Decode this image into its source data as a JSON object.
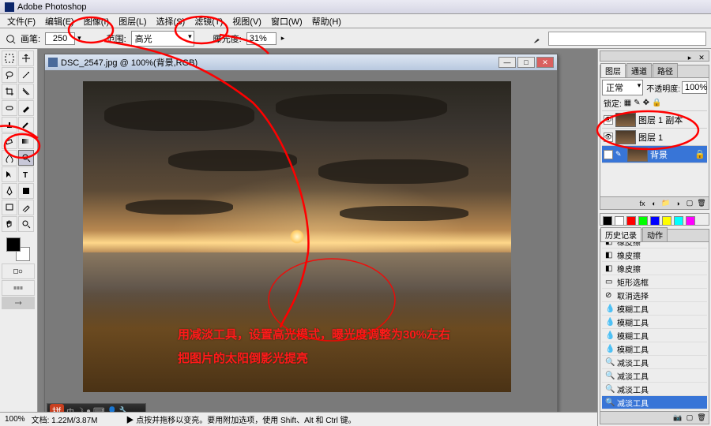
{
  "app_title": "Adobe Photoshop",
  "menu": [
    "文件(F)",
    "编辑(E)",
    "图像(I)",
    "图层(L)",
    "选择(S)",
    "滤镜(T)",
    "视图(V)",
    "窗口(W)",
    "帮助(H)"
  ],
  "options_bar": {
    "brush_label": "画笔:",
    "brush_value": "250",
    "range_label": "范围:",
    "range_value": "高光",
    "exposure_label": "曝光度:",
    "exposure_value": "31%"
  },
  "document": {
    "title": "DSC_2547.jpg @ 100%(背景,RGB)"
  },
  "annotation": {
    "line1": "用减淡工具，设置高光模式，曝光度调整为30%左右",
    "line2": "把图片的太阳倒影光提亮"
  },
  "status": {
    "zoom": "100%",
    "docinfo": "文档: 1.22M/3.87M",
    "hint": "▶ 点按并拖移以变亮。要用附加选项，使用 Shift、Alt 和 Ctrl 键。"
  },
  "layers_panel": {
    "tabs": [
      "图层",
      "通道",
      "路径"
    ],
    "mode_label": "正常",
    "opacity_label": "不透明度:",
    "opacity_value": "100%",
    "lock_label": "锁定:",
    "layers": [
      {
        "name": "图层 1 副本",
        "active": false
      },
      {
        "name": "图层 1",
        "active": false
      },
      {
        "name": "背景",
        "active": true,
        "locked": true
      }
    ]
  },
  "history_panel": {
    "tabs": [
      "历史记录",
      "动作"
    ],
    "items": [
      {
        "icon": "eraser",
        "label": "橡皮擦"
      },
      {
        "icon": "eraser",
        "label": "橡皮擦"
      },
      {
        "icon": "eraser",
        "label": "橡皮擦"
      },
      {
        "icon": "eraser",
        "label": "橡皮擦"
      },
      {
        "icon": "eraser",
        "label": "橡皮擦"
      },
      {
        "icon": "marquee",
        "label": "矩形选框"
      },
      {
        "icon": "deselect",
        "label": "取消选择"
      },
      {
        "icon": "blur",
        "label": "模糊工具"
      },
      {
        "icon": "blur",
        "label": "模糊工具"
      },
      {
        "icon": "blur",
        "label": "模糊工具"
      },
      {
        "icon": "blur",
        "label": "模糊工具"
      },
      {
        "icon": "dodge",
        "label": "减淡工具"
      },
      {
        "icon": "dodge",
        "label": "减淡工具"
      },
      {
        "icon": "dodge",
        "label": "减淡工具"
      },
      {
        "icon": "dodge",
        "label": "减淡工具",
        "active": true
      }
    ]
  },
  "small_badge": "拼"
}
